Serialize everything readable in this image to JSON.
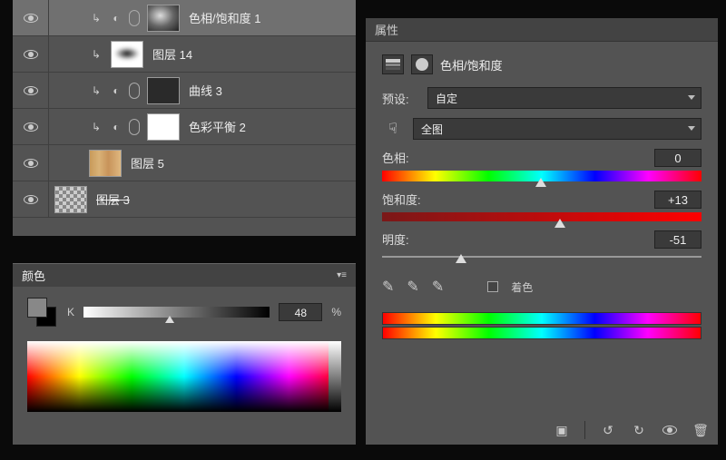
{
  "layers_panel": {
    "layers": [
      {
        "name": "色相/饱和度 1",
        "has_adj_icons": true,
        "thumb": "smoke",
        "selected": true
      },
      {
        "name": "图层 14",
        "has_adj_icons": false,
        "only_return": true,
        "thumb": "blur"
      },
      {
        "name": "曲线 3",
        "has_adj_icons": true,
        "thumb": "dark"
      },
      {
        "name": "色彩平衡 2",
        "has_adj_icons": true,
        "thumb": "white"
      },
      {
        "name": "图层 5",
        "has_adj_icons": false,
        "thumb": "wood"
      },
      {
        "name": "图层 3",
        "has_adj_icons": false,
        "thumb": "checker",
        "no_indent": true,
        "strike": true
      }
    ]
  },
  "color_panel": {
    "title": "颜色",
    "channel_label": "K",
    "channel_value": "48",
    "channel_unit": "%"
  },
  "props_panel": {
    "title": "属性",
    "adjustment_name": "色相/饱和度",
    "preset_label": "预设:",
    "preset_value": "自定",
    "range_value": "全图",
    "hue_label": "色相:",
    "hue_value": "0",
    "sat_label": "饱和度:",
    "sat_value": "+13",
    "light_label": "明度:",
    "light_value": "-51",
    "colorize_label": "着色"
  }
}
